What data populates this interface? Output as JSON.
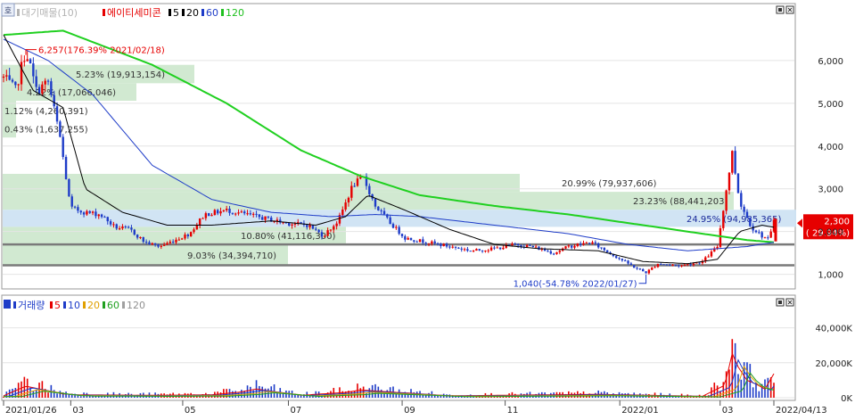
{
  "price_panel": {
    "legend": [
      {
        "label": "대기매물(10)",
        "color": "#b4b4b4"
      },
      {
        "label": "에이티세미콘",
        "color": "#e60000"
      },
      {
        "label": "5",
        "color": "#000000"
      },
      {
        "label": "20",
        "color": "#000000"
      },
      {
        "label": "60",
        "color": "#1e3cc8"
      },
      {
        "label": "120",
        "color": "#20c020"
      }
    ],
    "corner_tag": "호"
  },
  "volume_panel": {
    "legend": [
      {
        "label": "거래량",
        "color": "#1e3cc8"
      },
      {
        "label": "5",
        "color": "#e60000"
      },
      {
        "label": "10",
        "color": "#1e3cc8"
      },
      {
        "label": "20",
        "color": "#e0a000"
      },
      {
        "label": "60",
        "color": "#20a020"
      },
      {
        "label": "120",
        "color": "#a0a0a0"
      }
    ]
  },
  "chart_data": [
    {
      "type": "candlestick",
      "ylim": [
        700,
        7000
      ],
      "yticks": [
        1000,
        2000,
        3000,
        4000,
        5000,
        6000
      ],
      "ytick_labels": [
        "1,000",
        "2,000",
        "3,000",
        "4,000",
        "5,000",
        "6,000"
      ],
      "x_labels": [
        "2021/01/26",
        "03",
        "05",
        "07",
        "09",
        "11",
        "2022/01",
        "03",
        "2022/04/13"
      ],
      "high_annotation": {
        "text": "6,257(176.39% 2021/02/18)",
        "value": 6257
      },
      "low_annotation": {
        "text": "1,040(-54.78% 2022/01/27)",
        "value": 1040
      },
      "last_price": {
        "text": "2,300",
        "change": "( 29.94%)",
        "value": 2300
      },
      "supply_zones": [
        {
          "lo": 5470,
          "hi": 5900,
          "text": "5.23% (19,913,154)"
        },
        {
          "lo": 5060,
          "hi": 5470,
          "text": "4.22% (17,066,046)"
        },
        {
          "lo": 4600,
          "hi": 5060,
          "text": "1.12% (4,260,391)"
        },
        {
          "lo": 4200,
          "hi": 4600,
          "text": "0.43% (1,637,255)"
        },
        {
          "lo": 2930,
          "hi": 3350,
          "text": "20.99% (79,937,606)"
        },
        {
          "lo": 2510,
          "hi": 2930,
          "text": "23.23% (88,441,203)"
        },
        {
          "lo": 2110,
          "hi": 2510,
          "text": "24.95% (94,985,365)"
        },
        {
          "lo": 1700,
          "hi": 2110,
          "text": "10.80% (41,116,300)"
        },
        {
          "lo": 1210,
          "hi": 1700,
          "text": "9.03% (34,394,710)"
        }
      ],
      "price_series": [
        [
          0,
          5600
        ],
        [
          8,
          5300
        ],
        [
          15,
          6257
        ],
        [
          22,
          5300
        ],
        [
          30,
          5500
        ],
        [
          38,
          4200
        ],
        [
          45,
          2550
        ],
        [
          55,
          2450
        ],
        [
          65,
          2400
        ],
        [
          75,
          2100
        ],
        [
          85,
          2050
        ],
        [
          95,
          1750
        ],
        [
          105,
          1650
        ],
        [
          115,
          1800
        ],
        [
          125,
          1950
        ],
        [
          135,
          2400
        ],
        [
          150,
          2500
        ],
        [
          170,
          2350
        ],
        [
          190,
          2200
        ],
        [
          205,
          2150
        ],
        [
          215,
          1900
        ],
        [
          225,
          2250
        ],
        [
          235,
          3100
        ],
        [
          242,
          3250
        ],
        [
          250,
          2600
        ],
        [
          260,
          2200
        ],
        [
          270,
          1850
        ],
        [
          285,
          1750
        ],
        [
          300,
          1650
        ],
        [
          315,
          1550
        ],
        [
          330,
          1600
        ],
        [
          345,
          1700
        ],
        [
          355,
          1650
        ],
        [
          370,
          1500
        ],
        [
          380,
          1650
        ],
        [
          395,
          1750
        ],
        [
          405,
          1550
        ],
        [
          415,
          1350
        ],
        [
          425,
          1150
        ],
        [
          432,
          1040
        ],
        [
          440,
          1250
        ],
        [
          455,
          1200
        ],
        [
          470,
          1300
        ],
        [
          480,
          1650
        ],
        [
          490,
          3850
        ],
        [
          495,
          2700
        ],
        [
          503,
          2100
        ],
        [
          510,
          1900
        ],
        [
          515,
          1800
        ],
        [
          518,
          2300
        ]
      ],
      "ma20_series": [
        [
          0,
          6600
        ],
        [
          20,
          5300
        ],
        [
          40,
          4900
        ],
        [
          55,
          3000
        ],
        [
          80,
          2450
        ],
        [
          110,
          2150
        ],
        [
          140,
          2150
        ],
        [
          180,
          2250
        ],
        [
          210,
          2150
        ],
        [
          230,
          2350
        ],
        [
          245,
          2850
        ],
        [
          270,
          2500
        ],
        [
          300,
          2050
        ],
        [
          330,
          1700
        ],
        [
          360,
          1600
        ],
        [
          400,
          1550
        ],
        [
          430,
          1300
        ],
        [
          460,
          1250
        ],
        [
          480,
          1350
        ],
        [
          495,
          2000
        ],
        [
          510,
          2150
        ],
        [
          518,
          2100
        ]
      ],
      "ma60_series": [
        [
          0,
          6500
        ],
        [
          30,
          6000
        ],
        [
          60,
          5200
        ],
        [
          100,
          3550
        ],
        [
          140,
          2750
        ],
        [
          180,
          2450
        ],
        [
          220,
          2350
        ],
        [
          250,
          2400
        ],
        [
          280,
          2350
        ],
        [
          330,
          2150
        ],
        [
          380,
          1950
        ],
        [
          420,
          1700
        ],
        [
          460,
          1550
        ],
        [
          500,
          1650
        ],
        [
          518,
          1750
        ]
      ],
      "ma120_series": [
        [
          0,
          6600
        ],
        [
          40,
          6700
        ],
        [
          100,
          5900
        ],
        [
          150,
          5000
        ],
        [
          200,
          3900
        ],
        [
          240,
          3300
        ],
        [
          280,
          2850
        ],
        [
          330,
          2600
        ],
        [
          380,
          2400
        ],
        [
          430,
          2150
        ],
        [
          470,
          1950
        ],
        [
          500,
          1800
        ],
        [
          518,
          1750
        ]
      ]
    },
    {
      "type": "bar",
      "ylim": [
        0,
        50000
      ],
      "yticks": [
        0,
        20000,
        40000
      ],
      "ytick_labels": [
        "0K",
        "20,000K",
        "40,000K"
      ],
      "volume_series": [
        [
          0,
          2000
        ],
        [
          15,
          12000
        ],
        [
          40,
          4000
        ],
        [
          50,
          3000
        ],
        [
          100,
          2500
        ],
        [
          140,
          3000
        ],
        [
          160,
          6000
        ],
        [
          170,
          9000
        ],
        [
          200,
          2500
        ],
        [
          230,
          5500
        ],
        [
          240,
          8000
        ],
        [
          300,
          2000
        ],
        [
          400,
          3500
        ],
        [
          470,
          1500
        ],
        [
          485,
          13000
        ],
        [
          490,
          46000
        ],
        [
          494,
          32000
        ],
        [
          500,
          18000
        ],
        [
          505,
          15000
        ],
        [
          512,
          9000
        ],
        [
          518,
          25000
        ]
      ]
    }
  ]
}
